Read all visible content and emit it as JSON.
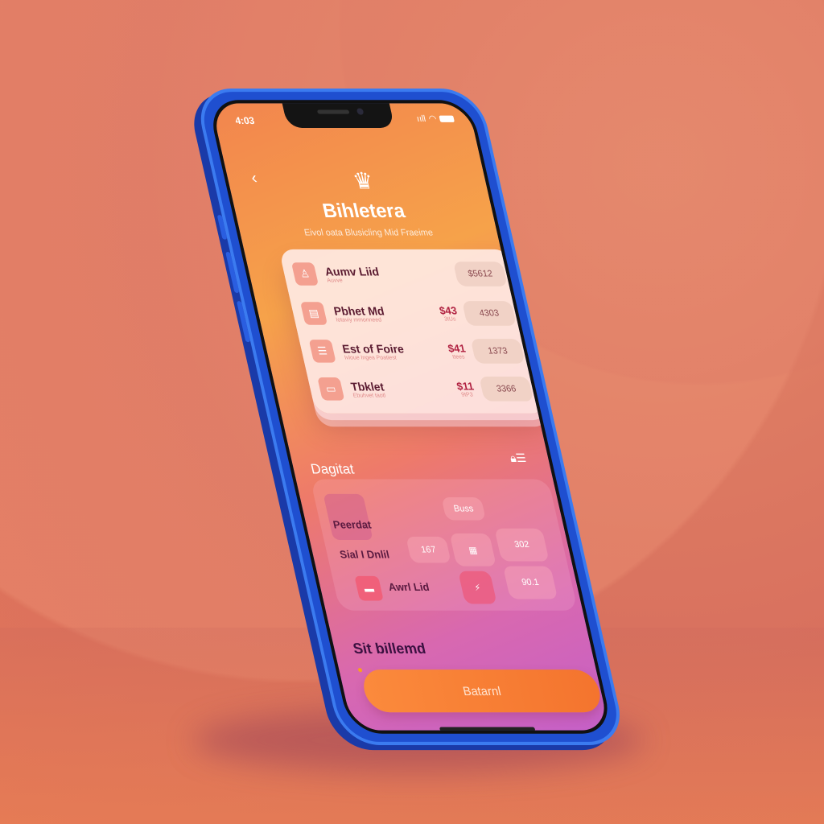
{
  "status": {
    "time": "4:03",
    "signal": "ııll",
    "wifi": "wifi"
  },
  "header": {
    "back": "‹",
    "title": "Bihletera",
    "subtitle": "Eivol oata Blusicling Mid Fraeime"
  },
  "ticket_card": {
    "rows": [
      {
        "name": "Aumv Liid",
        "sub": "Auvve",
        "mid": "",
        "mid_sub": "",
        "amount": "$5612"
      },
      {
        "name": "Pbhet Md",
        "sub": "Iotaviy mmonneed",
        "mid": "$43",
        "mid_sub": "3tUs",
        "amount": "4303"
      },
      {
        "name": "Est of Foire",
        "sub": "Ivloue Ingea Poatiest",
        "mid": "$41",
        "mid_sub": "ttees",
        "amount": "1373"
      },
      {
        "name": "Tbklet",
        "sub": "Ebuhvet taotl",
        "mid": "$11",
        "mid_sub": "9tP3",
        "amount": "3366"
      }
    ]
  },
  "digital": {
    "heading": "Dagitat",
    "label1": "Peerdat",
    "label2": "Sial I Dnlil",
    "label3": "Awrl Lid",
    "num": "167",
    "tile1": "Buss",
    "tile2": "302",
    "tile3": "90.1"
  },
  "footer": {
    "heading": "Sit billemd",
    "button": "Batarnl"
  },
  "colors": {
    "accent": "#f4742e",
    "frame": "#1f4fd0"
  }
}
